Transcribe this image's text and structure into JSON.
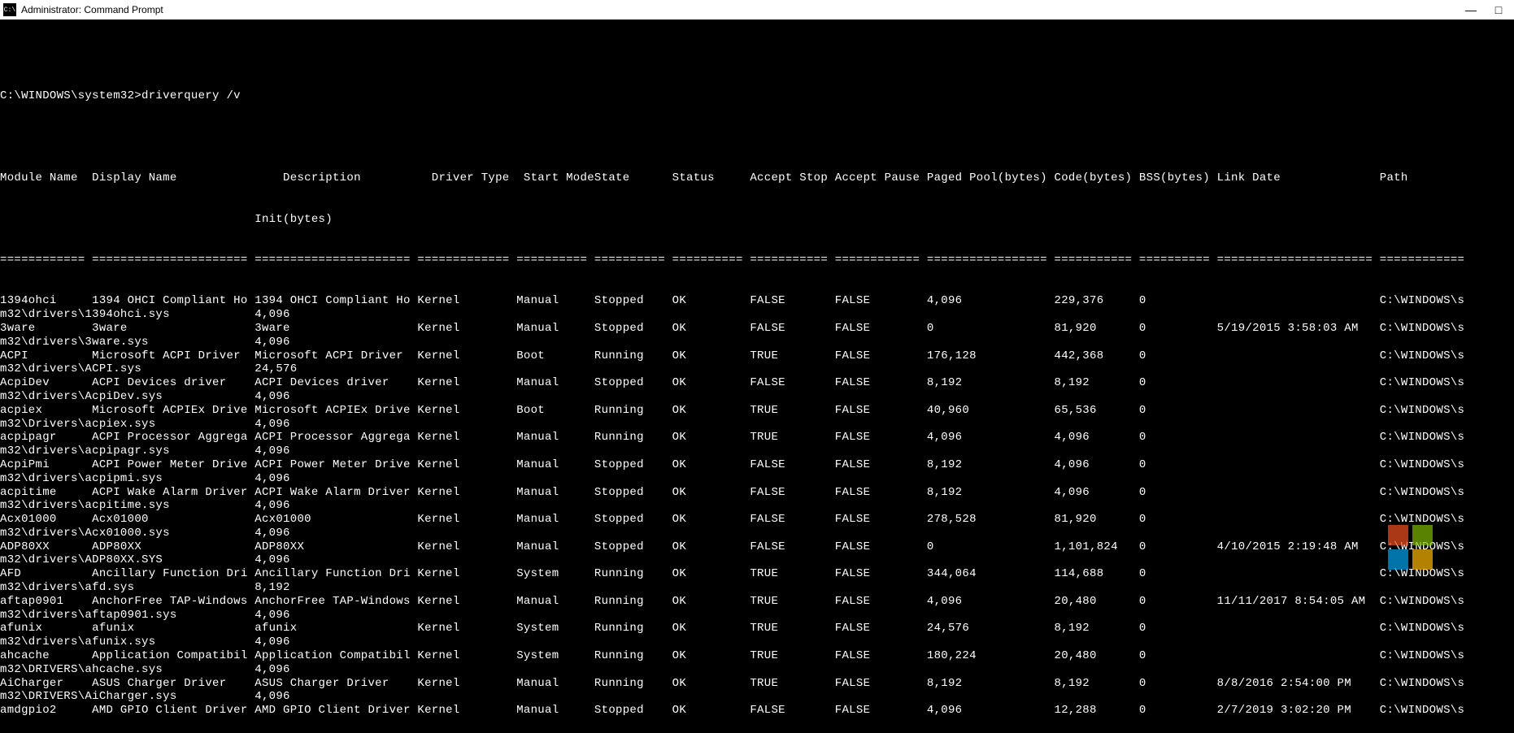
{
  "window": {
    "title": "Administrator: Command Prompt",
    "icon_label": "C:\\"
  },
  "prompt": "C:\\WINDOWS\\system32>driverquery /v",
  "headers_line1": "Module Name  Display Name           Description              Driver Type   Start Mode State   Status     Accept Stop Accept Pause Paged Pool(bytes) Code(bytes) BSS(bytes) Link Date              Path",
  "headers_line2": "                                    Init(bytes)",
  "separator": "============ ====================== ======================== ============= ========== ======= ========== =========== ============ ================= =========== ========== ====================== ============",
  "drivers": [
    {
      "module": "1394ohci",
      "display": "1394 OHCI Compliant Ho",
      "desc": "1394 OHCI Compliant Ho",
      "type": "Kernel",
      "start": "Manual",
      "state": "Stopped",
      "status": "OK",
      "stop": "FALSE",
      "pause": "FALSE",
      "paged": "4,096",
      "code": "229,376",
      "bss": "0",
      "link": "",
      "path": "C:\\WINDOWS\\s",
      "line2_path": "m32\\drivers\\1394ohci.sys",
      "line2_init": "4,096"
    },
    {
      "module": "3ware",
      "display": "3ware",
      "desc": "3ware",
      "type": "Kernel",
      "start": "Manual",
      "state": "Stopped",
      "status": "OK",
      "stop": "FALSE",
      "pause": "FALSE",
      "paged": "0",
      "code": "81,920",
      "bss": "0",
      "link": "5/19/2015 3:58:03 AM",
      "path": "C:\\WINDOWS\\s",
      "line2_path": "m32\\drivers\\3ware.sys",
      "line2_init": "4,096"
    },
    {
      "module": "ACPI",
      "display": "Microsoft ACPI Driver",
      "desc": "Microsoft ACPI Driver",
      "type": "Kernel",
      "start": "Boot",
      "state": "Running",
      "status": "OK",
      "stop": "TRUE",
      "pause": "FALSE",
      "paged": "176,128",
      "code": "442,368",
      "bss": "0",
      "link": "",
      "path": "C:\\WINDOWS\\s",
      "line2_path": "m32\\drivers\\ACPI.sys",
      "line2_init": "24,576"
    },
    {
      "module": "AcpiDev",
      "display": "ACPI Devices driver",
      "desc": "ACPI Devices driver",
      "type": "Kernel",
      "start": "Manual",
      "state": "Stopped",
      "status": "OK",
      "stop": "FALSE",
      "pause": "FALSE",
      "paged": "8,192",
      "code": "8,192",
      "bss": "0",
      "link": "",
      "path": "C:\\WINDOWS\\s",
      "line2_path": "m32\\drivers\\AcpiDev.sys",
      "line2_init": "4,096"
    },
    {
      "module": "acpiex",
      "display": "Microsoft ACPIEx Drive",
      "desc": "Microsoft ACPIEx Drive",
      "type": "Kernel",
      "start": "Boot",
      "state": "Running",
      "status": "OK",
      "stop": "TRUE",
      "pause": "FALSE",
      "paged": "40,960",
      "code": "65,536",
      "bss": "0",
      "link": "",
      "path": "C:\\WINDOWS\\s",
      "line2_path": "m32\\Drivers\\acpiex.sys",
      "line2_init": "4,096"
    },
    {
      "module": "acpipagr",
      "display": "ACPI Processor Aggrega",
      "desc": "ACPI Processor Aggrega",
      "type": "Kernel",
      "start": "Manual",
      "state": "Running",
      "status": "OK",
      "stop": "TRUE",
      "pause": "FALSE",
      "paged": "4,096",
      "code": "4,096",
      "bss": "0",
      "link": "",
      "path": "C:\\WINDOWS\\s",
      "line2_path": "m32\\drivers\\acpipagr.sys",
      "line2_init": "4,096"
    },
    {
      "module": "AcpiPmi",
      "display": "ACPI Power Meter Drive",
      "desc": "ACPI Power Meter Drive",
      "type": "Kernel",
      "start": "Manual",
      "state": "Stopped",
      "status": "OK",
      "stop": "FALSE",
      "pause": "FALSE",
      "paged": "8,192",
      "code": "4,096",
      "bss": "0",
      "link": "",
      "path": "C:\\WINDOWS\\s",
      "line2_path": "m32\\drivers\\acpipmi.sys",
      "line2_init": "4,096"
    },
    {
      "module": "acpitime",
      "display": "ACPI Wake Alarm Driver",
      "desc": "ACPI Wake Alarm Driver",
      "type": "Kernel",
      "start": "Manual",
      "state": "Stopped",
      "status": "OK",
      "stop": "FALSE",
      "pause": "FALSE",
      "paged": "8,192",
      "code": "4,096",
      "bss": "0",
      "link": "",
      "path": "C:\\WINDOWS\\s",
      "line2_path": "m32\\drivers\\acpitime.sys",
      "line2_init": "4,096"
    },
    {
      "module": "Acx01000",
      "display": "Acx01000",
      "desc": "Acx01000",
      "type": "Kernel",
      "start": "Manual",
      "state": "Stopped",
      "status": "OK",
      "stop": "FALSE",
      "pause": "FALSE",
      "paged": "278,528",
      "code": "81,920",
      "bss": "0",
      "link": "",
      "path": "C:\\WINDOWS\\s",
      "line2_path": "m32\\drivers\\Acx01000.sys",
      "line2_init": "4,096"
    },
    {
      "module": "ADP80XX",
      "display": "ADP80XX",
      "desc": "ADP80XX",
      "type": "Kernel",
      "start": "Manual",
      "state": "Stopped",
      "status": "OK",
      "stop": "FALSE",
      "pause": "FALSE",
      "paged": "0",
      "code": "1,101,824",
      "bss": "0",
      "link": "4/10/2015 2:19:48 AM",
      "path": "C:\\WINDOWS\\s",
      "line2_path": "m32\\drivers\\ADP80XX.SYS",
      "line2_init": "4,096"
    },
    {
      "module": "AFD",
      "display": "Ancillary Function Dri",
      "desc": "Ancillary Function Dri",
      "type": "Kernel",
      "start": "System",
      "state": "Running",
      "status": "OK",
      "stop": "TRUE",
      "pause": "FALSE",
      "paged": "344,064",
      "code": "114,688",
      "bss": "0",
      "link": "",
      "path": "C:\\WINDOWS\\s",
      "line2_path": "m32\\drivers\\afd.sys",
      "line2_init": "8,192"
    },
    {
      "module": "aftap0901",
      "display": "AnchorFree TAP-Windows",
      "desc": "AnchorFree TAP-Windows",
      "type": "Kernel",
      "start": "Manual",
      "state": "Running",
      "status": "OK",
      "stop": "TRUE",
      "pause": "FALSE",
      "paged": "4,096",
      "code": "20,480",
      "bss": "0",
      "link": "11/11/2017 8:54:05 AM",
      "path": "C:\\WINDOWS\\s",
      "line2_path": "m32\\drivers\\aftap0901.sys",
      "line2_init": "4,096"
    },
    {
      "module": "afunix",
      "display": "afunix",
      "desc": "afunix",
      "type": "Kernel",
      "start": "System",
      "state": "Running",
      "status": "OK",
      "stop": "TRUE",
      "pause": "FALSE",
      "paged": "24,576",
      "code": "8,192",
      "bss": "0",
      "link": "",
      "path": "C:\\WINDOWS\\s",
      "line2_path": "m32\\drivers\\afunix.sys",
      "line2_init": "4,096"
    },
    {
      "module": "ahcache",
      "display": "Application Compatibil",
      "desc": "Application Compatibil",
      "type": "Kernel",
      "start": "System",
      "state": "Running",
      "status": "OK",
      "stop": "TRUE",
      "pause": "FALSE",
      "paged": "180,224",
      "code": "20,480",
      "bss": "0",
      "link": "",
      "path": "C:\\WINDOWS\\s",
      "line2_path": "m32\\DRIVERS\\ahcache.sys",
      "line2_init": "4,096"
    },
    {
      "module": "AiCharger",
      "display": "ASUS Charger Driver",
      "desc": "ASUS Charger Driver",
      "type": "Kernel",
      "start": "Manual",
      "state": "Running",
      "status": "OK",
      "stop": "TRUE",
      "pause": "FALSE",
      "paged": "8,192",
      "code": "8,192",
      "bss": "0",
      "link": "8/8/2016 2:54:00 PM",
      "path": "C:\\WINDOWS\\s",
      "line2_path": "m32\\DRIVERS\\AiCharger.sys",
      "line2_init": "4,096"
    },
    {
      "module": "amdgpio2",
      "display": "AMD GPIO Client Driver",
      "desc": "AMD GPIO Client Driver",
      "type": "Kernel",
      "start": "Manual",
      "state": "Stopped",
      "status": "OK",
      "stop": "FALSE",
      "pause": "FALSE",
      "paged": "4,096",
      "code": "12,288",
      "bss": "0",
      "link": "2/7/2019 3:02:20 PM",
      "path": "C:\\WINDOWS\\s",
      "line2_path": "",
      "line2_init": ""
    }
  ]
}
